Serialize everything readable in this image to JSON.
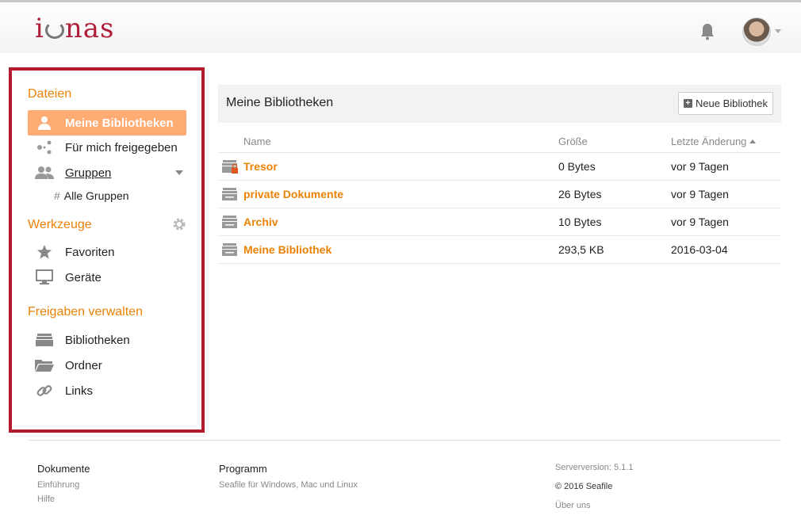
{
  "header": {
    "logo_prefix": "i",
    "logo_suffix": "nas",
    "notifications_icon": "bell-icon",
    "avatar_icon": "user-avatar"
  },
  "sidebar": {
    "files_heading": "Dateien",
    "items": [
      {
        "label": "Meine Bibliotheken",
        "icon": "user-icon"
      },
      {
        "label": "Für mich freigegeben",
        "icon": "share-icon"
      },
      {
        "label": "Gruppen",
        "icon": "group-icon"
      },
      {
        "label": "Alle Gruppen",
        "prefix": "#"
      }
    ],
    "tools_heading": "Werkzeuge",
    "tools": [
      {
        "label": "Favoriten",
        "icon": "star-icon"
      },
      {
        "label": "Geräte",
        "icon": "monitor-icon"
      }
    ],
    "share_heading": "Freigaben verwalten",
    "share_items": [
      {
        "label": "Bibliotheken",
        "icon": "library-icon"
      },
      {
        "label": "Ordner",
        "icon": "folder-icon"
      },
      {
        "label": "Links",
        "icon": "link-icon"
      }
    ],
    "active_color": "#feac74",
    "heading_color": "#eb8205"
  },
  "main": {
    "title": "Meine Bibliotheken",
    "new_library_label": "Neue Bibliothek",
    "columns": {
      "name": "Name",
      "size": "Größe",
      "modified": "Letzte Änderung"
    },
    "rows": [
      {
        "name": "Tresor",
        "size": "0 Bytes",
        "modified": "vor 9 Tagen",
        "encrypted": true
      },
      {
        "name": "private Dokumente",
        "size": "26 Bytes",
        "modified": "vor 9 Tagen",
        "encrypted": false
      },
      {
        "name": "Archiv",
        "size": "10 Bytes",
        "modified": "vor 9 Tagen",
        "encrypted": false
      },
      {
        "name": "Meine Bibliothek",
        "size": "293,5 KB",
        "modified": "2016-03-04",
        "encrypted": false
      }
    ]
  },
  "footer": {
    "col1_heading": "Dokumente",
    "col1_links": [
      "Einführung",
      "Hilfe"
    ],
    "col2_heading": "Programm",
    "col2_links": [
      "Seafile für Windows, Mac und Linux"
    ],
    "server_version": "Serverversion: 5.1.1",
    "copyright": "© 2016 Seafile",
    "about": "Über uns"
  }
}
